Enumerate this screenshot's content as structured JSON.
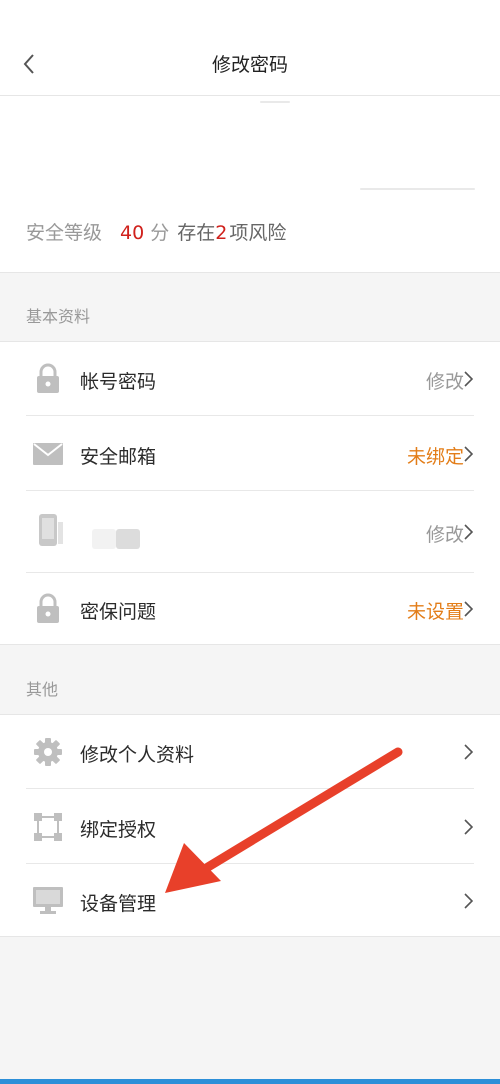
{
  "navbar": {
    "title": "修改密码",
    "back_icon": "chevron-left-icon"
  },
  "security": {
    "label": "安全等级",
    "score": "40",
    "score_unit": "分",
    "risk_prefix": "存在",
    "risk_count": "2",
    "risk_suffix": "项风险",
    "score_color": "#d0211c"
  },
  "sections": {
    "basic": {
      "header": "基本资料",
      "items": [
        {
          "label": "帐号密码",
          "value": "修改",
          "icon": "lock-icon",
          "value_color": "#999999"
        },
        {
          "label": "安全邮箱",
          "value": "未绑定",
          "icon": "mail-icon",
          "value_color": "#e37d18"
        },
        {
          "label": "",
          "value": "修改",
          "icon": "phone-icon",
          "value_color": "#999999"
        },
        {
          "label": "密保问题",
          "value": "未设置",
          "icon": "lock-icon",
          "value_color": "#e37d18"
        }
      ]
    },
    "other": {
      "header": "其他",
      "items": [
        {
          "label": "修改个人资料",
          "icon": "gear-icon"
        },
        {
          "label": "绑定授权",
          "icon": "connection-icon"
        },
        {
          "label": "设备管理",
          "icon": "monitor-icon"
        }
      ]
    }
  },
  "colors": {
    "accent_red": "#d0211c",
    "accent_orange": "#e37d18",
    "annotation_arrow": "#e8402a",
    "bottom_bar": "#2d8fd8"
  }
}
